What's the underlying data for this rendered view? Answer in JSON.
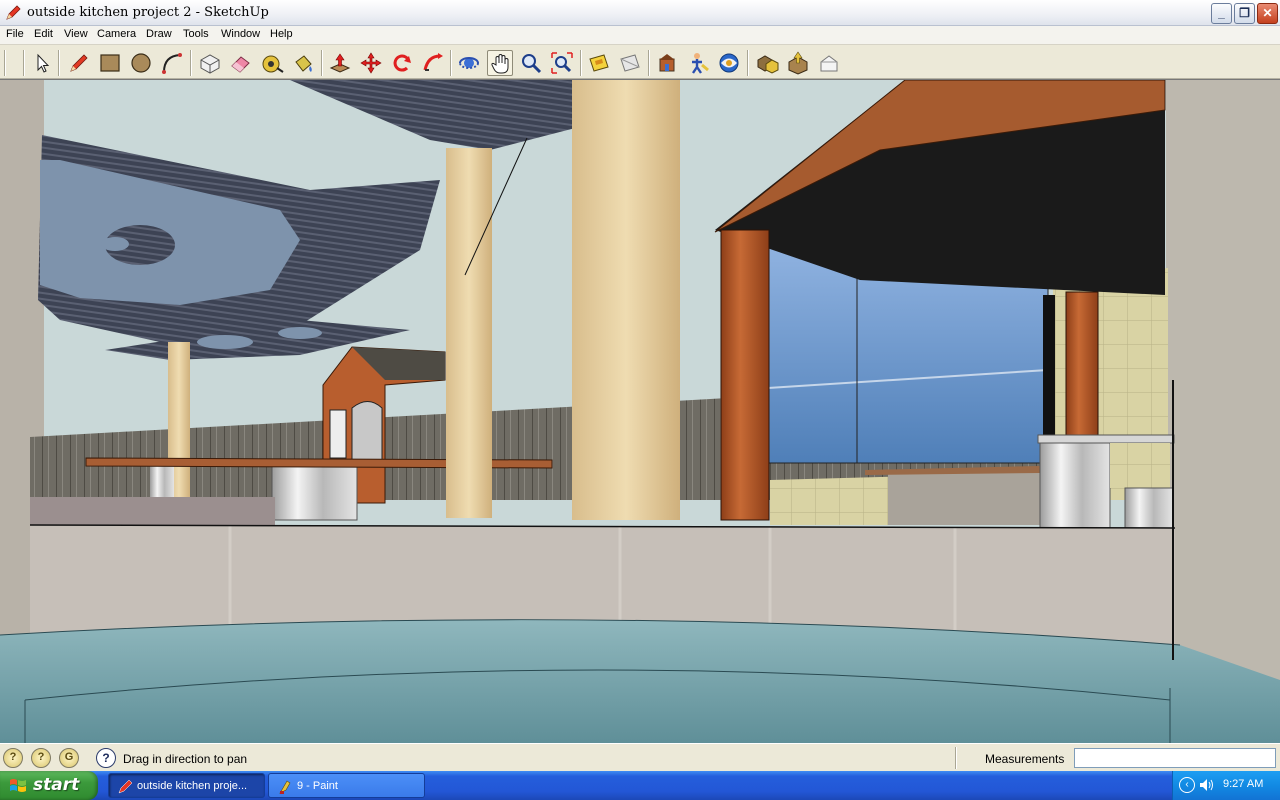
{
  "window": {
    "title": "outside kitchen project 2 - SketchUp",
    "app_icon": "sketchup-pencil-icon",
    "controls": [
      "minimize-icon",
      "restore-icon",
      "close-icon"
    ]
  },
  "menubar": {
    "items": [
      "File",
      "Edit",
      "View",
      "Camera",
      "Draw",
      "Tools",
      "Window",
      "Help"
    ]
  },
  "toolbar": {
    "tools": [
      "select-arrow-icon",
      "pencil-line-icon",
      "rectangle-icon",
      "circle-icon",
      "arc-icon",
      "make-component-icon",
      "eraser-icon",
      "tape-measure-icon",
      "paint-bucket-icon",
      "push-pull-icon",
      "move-icon",
      "rotate-icon",
      "follow-me-icon",
      "orbit-icon",
      "pan-hand-icon",
      "zoom-icon",
      "zoom-extents-icon",
      "section-plane-icon",
      "section-display-icon",
      "get-models-icon",
      "walk-look-icon",
      "share-model-icon",
      "components-icon",
      "materials-icon",
      "styles-icon"
    ],
    "active_tool": "pan-hand-icon"
  },
  "statusbar": {
    "geo_icons": [
      "geo-location-icon",
      "credits-icon",
      "sign-in-icon"
    ],
    "help_icon": "?",
    "message": "Drag in direction to pan",
    "measurements_label": "Measurements",
    "measurements_value": ""
  },
  "taskbar": {
    "start_label": "start",
    "tasks": [
      {
        "label": "outside kitchen proje...",
        "icon": "sketchup-pencil-icon",
        "active": true
      },
      {
        "label": "9 - Paint",
        "icon": "paint-brush-icon",
        "active": false
      }
    ],
    "clock": "9:27 AM"
  },
  "colors": {
    "sky": "#c9d8d8",
    "roof_wood": "#a65b2f",
    "column_wood": "#b85e2e",
    "pool_water": "#7fa8b0",
    "fence": "#6f6c64",
    "concrete_wall": "#c6bfb8",
    "taskbar_blue": "#245edc"
  }
}
